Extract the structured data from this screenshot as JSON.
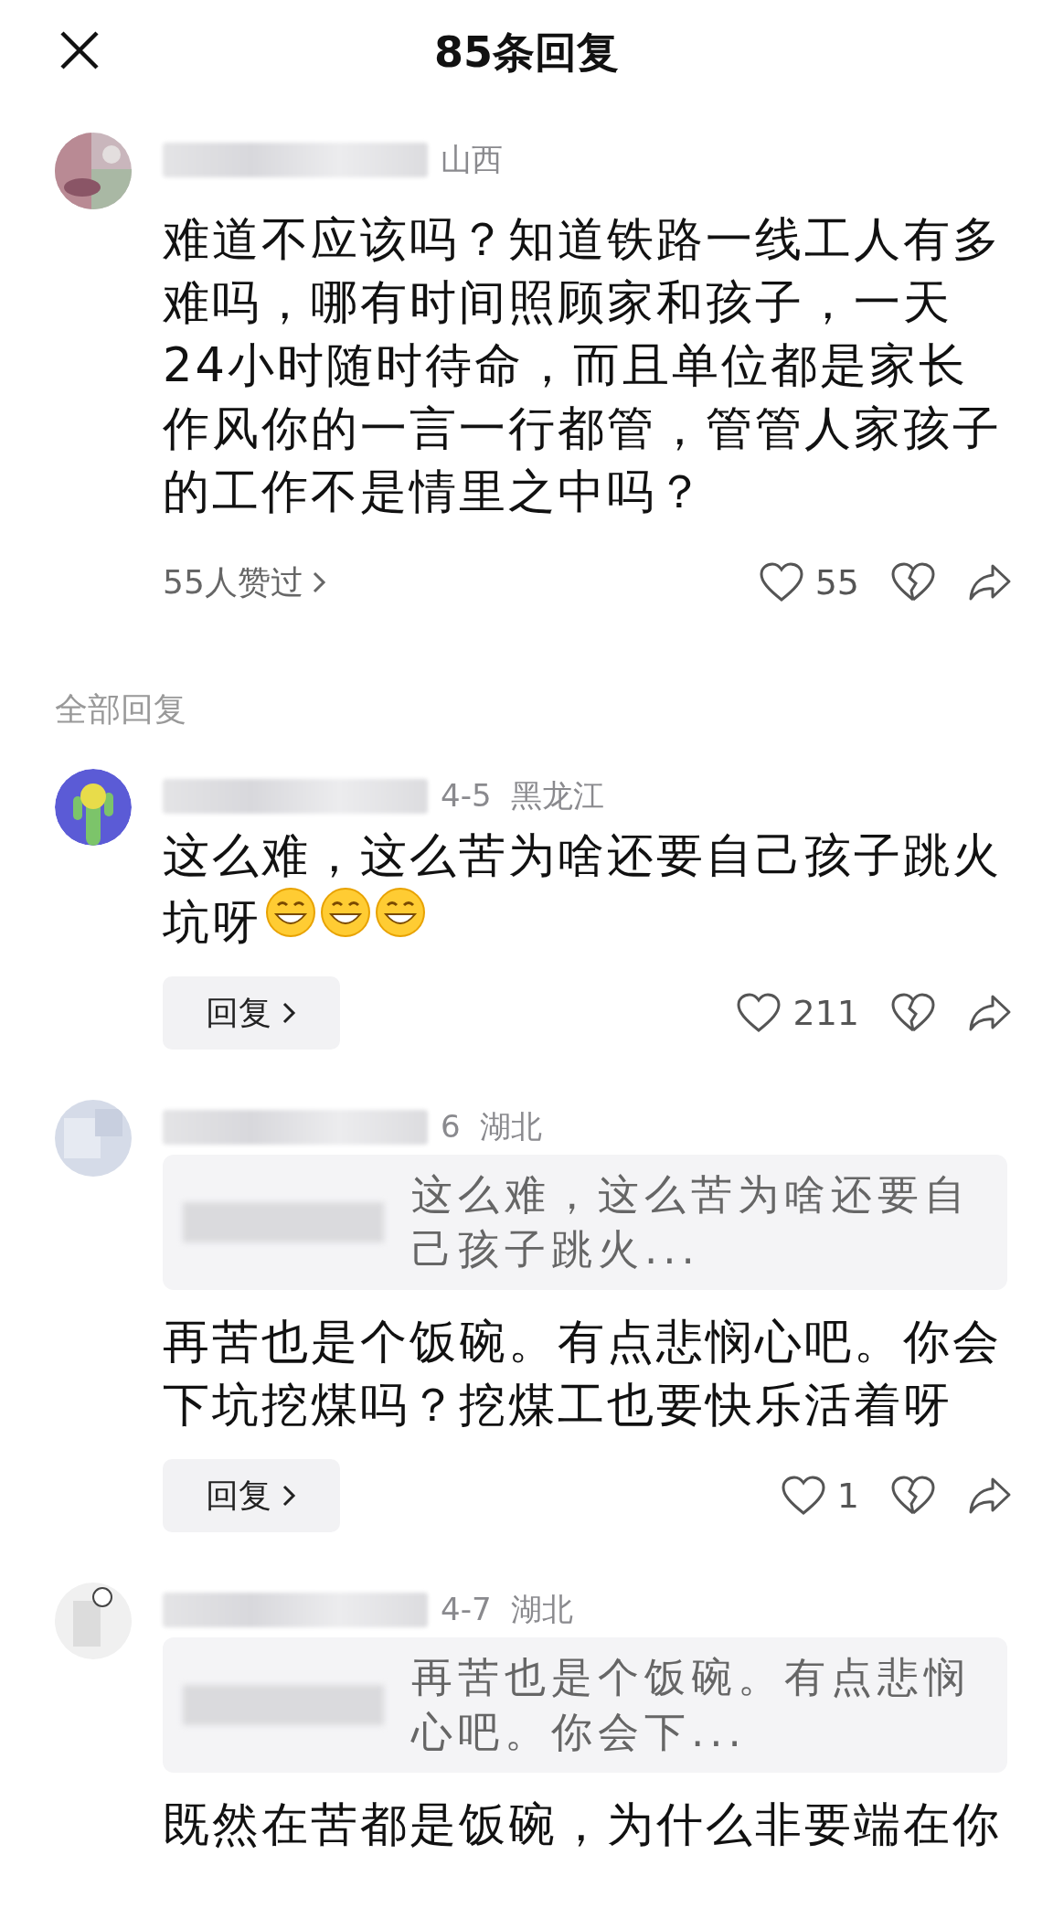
{
  "header": {
    "title": "85条回复"
  },
  "top_comment": {
    "name_redacted": true,
    "meta": "山西",
    "text": "难道不应该吗？知道铁路一线工人有多难吗，哪有时间照顾家和孩子，一天24小时随时待命，而且单位都是家长作风你的一言一行都管，管管人家孩子的工作不是情里之中吗？",
    "liked_by": "55人赞过",
    "likes": "55",
    "liked": false
  },
  "section_label": "全部回复",
  "replies": [
    {
      "avatar": {
        "kind": "cactus"
      },
      "name_redacted": true,
      "meta": "4-5  黑龙江",
      "text": "这么难，这么苦为啥还要自己孩子跳火坑呀",
      "emojis": [
        {
          "kind": "grin"
        },
        {
          "kind": "grin"
        },
        {
          "kind": "grin"
        }
      ],
      "reply_button": "回复",
      "likes": "211",
      "liked": false
    },
    {
      "avatar": {
        "kind": "blurred"
      },
      "name_redacted": true,
      "meta": "6  湖北",
      "quote": "这么难，这么苦为啥还要自己孩子跳火...",
      "text": "再苦也是个饭碗。有点悲悯心吧。你会下坑挖煤吗？挖煤工也要快乐活着呀",
      "reply_button": "回复",
      "likes": "1",
      "liked": false
    },
    {
      "avatar": {
        "kind": "sketch"
      },
      "name_redacted": true,
      "meta": "4-7  湖北",
      "quote": "再苦也是个饭碗。有点悲悯心吧。你会下...",
      "text": "既然在苦都是饭碗，为什么非要端在你"
    }
  ]
}
